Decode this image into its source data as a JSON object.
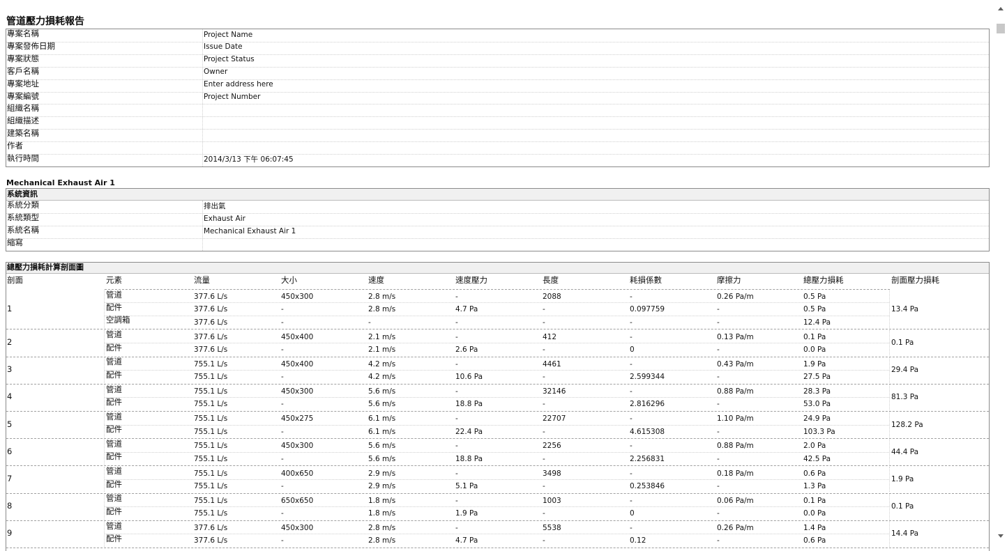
{
  "report": {
    "title": "管道壓力損耗報告"
  },
  "project_info": {
    "rows": [
      {
        "label": "專案名稱",
        "value": "Project Name"
      },
      {
        "label": "專案發佈日期",
        "value": "Issue Date"
      },
      {
        "label": "專案狀態",
        "value": "Project Status"
      },
      {
        "label": "客戶名稱",
        "value": "Owner"
      },
      {
        "label": "專案地址",
        "value": "Enter address here"
      },
      {
        "label": "專案編號",
        "value": "Project Number"
      },
      {
        "label": "組織名稱",
        "value": ""
      },
      {
        "label": "組織描述",
        "value": ""
      },
      {
        "label": "建築名稱",
        "value": ""
      },
      {
        "label": "作者",
        "value": ""
      },
      {
        "label": "執行時間",
        "value": "2014/3/13 下午 06:07:45"
      }
    ]
  },
  "system": {
    "name_heading": "Mechanical Exhaust Air 1",
    "info_heading": "系統資訊",
    "rows": [
      {
        "label": "系統分類",
        "value": "排出氣"
      },
      {
        "label": "系統類型",
        "value": "Exhaust Air"
      },
      {
        "label": "系統名稱",
        "value": "Mechanical Exhaust Air 1"
      },
      {
        "label": "縮寫",
        "value": ""
      }
    ]
  },
  "loss_table": {
    "heading": "總壓力損耗計算剖面圖",
    "columns": [
      "剖面",
      "元素",
      "流量",
      "大小",
      "速度",
      "速度壓力",
      "長度",
      "耗損係數",
      "摩擦力",
      "總壓力損耗",
      "剖面壓力損耗"
    ],
    "sections": [
      {
        "id": "1",
        "total": "13.4 Pa",
        "rows": [
          [
            "管道",
            "377.6 L/s",
            "450x300",
            "2.8 m/s",
            "-",
            "2088",
            "-",
            "0.26 Pa/m",
            "0.5 Pa"
          ],
          [
            "配件",
            "377.6 L/s",
            "-",
            "2.8 m/s",
            "4.7 Pa",
            "-",
            "0.097759",
            "-",
            "0.5 Pa"
          ],
          [
            "空調箱",
            "377.6 L/s",
            "-",
            "-",
            "-",
            "-",
            "-",
            "-",
            "12.4 Pa"
          ]
        ]
      },
      {
        "id": "2",
        "total": "0.1 Pa",
        "rows": [
          [
            "管道",
            "377.6 L/s",
            "450x400",
            "2.1 m/s",
            "-",
            "412",
            "-",
            "0.13 Pa/m",
            "0.1 Pa"
          ],
          [
            "配件",
            "377.6 L/s",
            "-",
            "2.1 m/s",
            "2.6 Pa",
            "-",
            "0",
            "-",
            "0.0 Pa"
          ]
        ]
      },
      {
        "id": "3",
        "total": "29.4 Pa",
        "rows": [
          [
            "管道",
            "755.1 L/s",
            "450x400",
            "4.2 m/s",
            "-",
            "4461",
            "-",
            "0.43 Pa/m",
            "1.9 Pa"
          ],
          [
            "配件",
            "755.1 L/s",
            "-",
            "4.2 m/s",
            "10.6 Pa",
            "-",
            "2.599344",
            "-",
            "27.5 Pa"
          ]
        ]
      },
      {
        "id": "4",
        "total": "81.3 Pa",
        "rows": [
          [
            "管道",
            "755.1 L/s",
            "450x300",
            "5.6 m/s",
            "-",
            "32146",
            "-",
            "0.88 Pa/m",
            "28.3 Pa"
          ],
          [
            "配件",
            "755.1 L/s",
            "-",
            "5.6 m/s",
            "18.8 Pa",
            "-",
            "2.816296",
            "-",
            "53.0 Pa"
          ]
        ]
      },
      {
        "id": "5",
        "total": "128.2 Pa",
        "rows": [
          [
            "管道",
            "755.1 L/s",
            "450x275",
            "6.1 m/s",
            "-",
            "22707",
            "-",
            "1.10 Pa/m",
            "24.9 Pa"
          ],
          [
            "配件",
            "755.1 L/s",
            "-",
            "6.1 m/s",
            "22.4 Pa",
            "-",
            "4.615308",
            "-",
            "103.3 Pa"
          ]
        ]
      },
      {
        "id": "6",
        "total": "44.4 Pa",
        "rows": [
          [
            "管道",
            "755.1 L/s",
            "450x300",
            "5.6 m/s",
            "-",
            "2256",
            "-",
            "0.88 Pa/m",
            "2.0 Pa"
          ],
          [
            "配件",
            "755.1 L/s",
            "-",
            "5.6 m/s",
            "18.8 Pa",
            "-",
            "2.256831",
            "-",
            "42.5 Pa"
          ]
        ]
      },
      {
        "id": "7",
        "total": "1.9 Pa",
        "rows": [
          [
            "管道",
            "755.1 L/s",
            "400x650",
            "2.9 m/s",
            "-",
            "3498",
            "-",
            "0.18 Pa/m",
            "0.6 Pa"
          ],
          [
            "配件",
            "755.1 L/s",
            "-",
            "2.9 m/s",
            "5.1 Pa",
            "-",
            "0.253846",
            "-",
            "1.3 Pa"
          ]
        ]
      },
      {
        "id": "8",
        "total": "0.1 Pa",
        "rows": [
          [
            "管道",
            "755.1 L/s",
            "650x650",
            "1.8 m/s",
            "-",
            "1003",
            "-",
            "0.06 Pa/m",
            "0.1 Pa"
          ],
          [
            "配件",
            "755.1 L/s",
            "-",
            "1.8 m/s",
            "1.9 Pa",
            "-",
            "0",
            "-",
            "0.0 Pa"
          ]
        ]
      },
      {
        "id": "9",
        "total": "14.4 Pa",
        "rows": [
          [
            "管道",
            "377.6 L/s",
            "450x300",
            "2.8 m/s",
            "-",
            "5538",
            "-",
            "0.26 Pa/m",
            "1.4 Pa"
          ],
          [
            "配件",
            "377.6 L/s",
            "-",
            "2.8 m/s",
            "4.7 Pa",
            "-",
            "0.12",
            "-",
            "0.6 Pa"
          ]
        ]
      }
    ]
  },
  "scrollbar": {
    "up_icon": "chevron-up-icon",
    "down_icon": "chevron-down-icon"
  }
}
